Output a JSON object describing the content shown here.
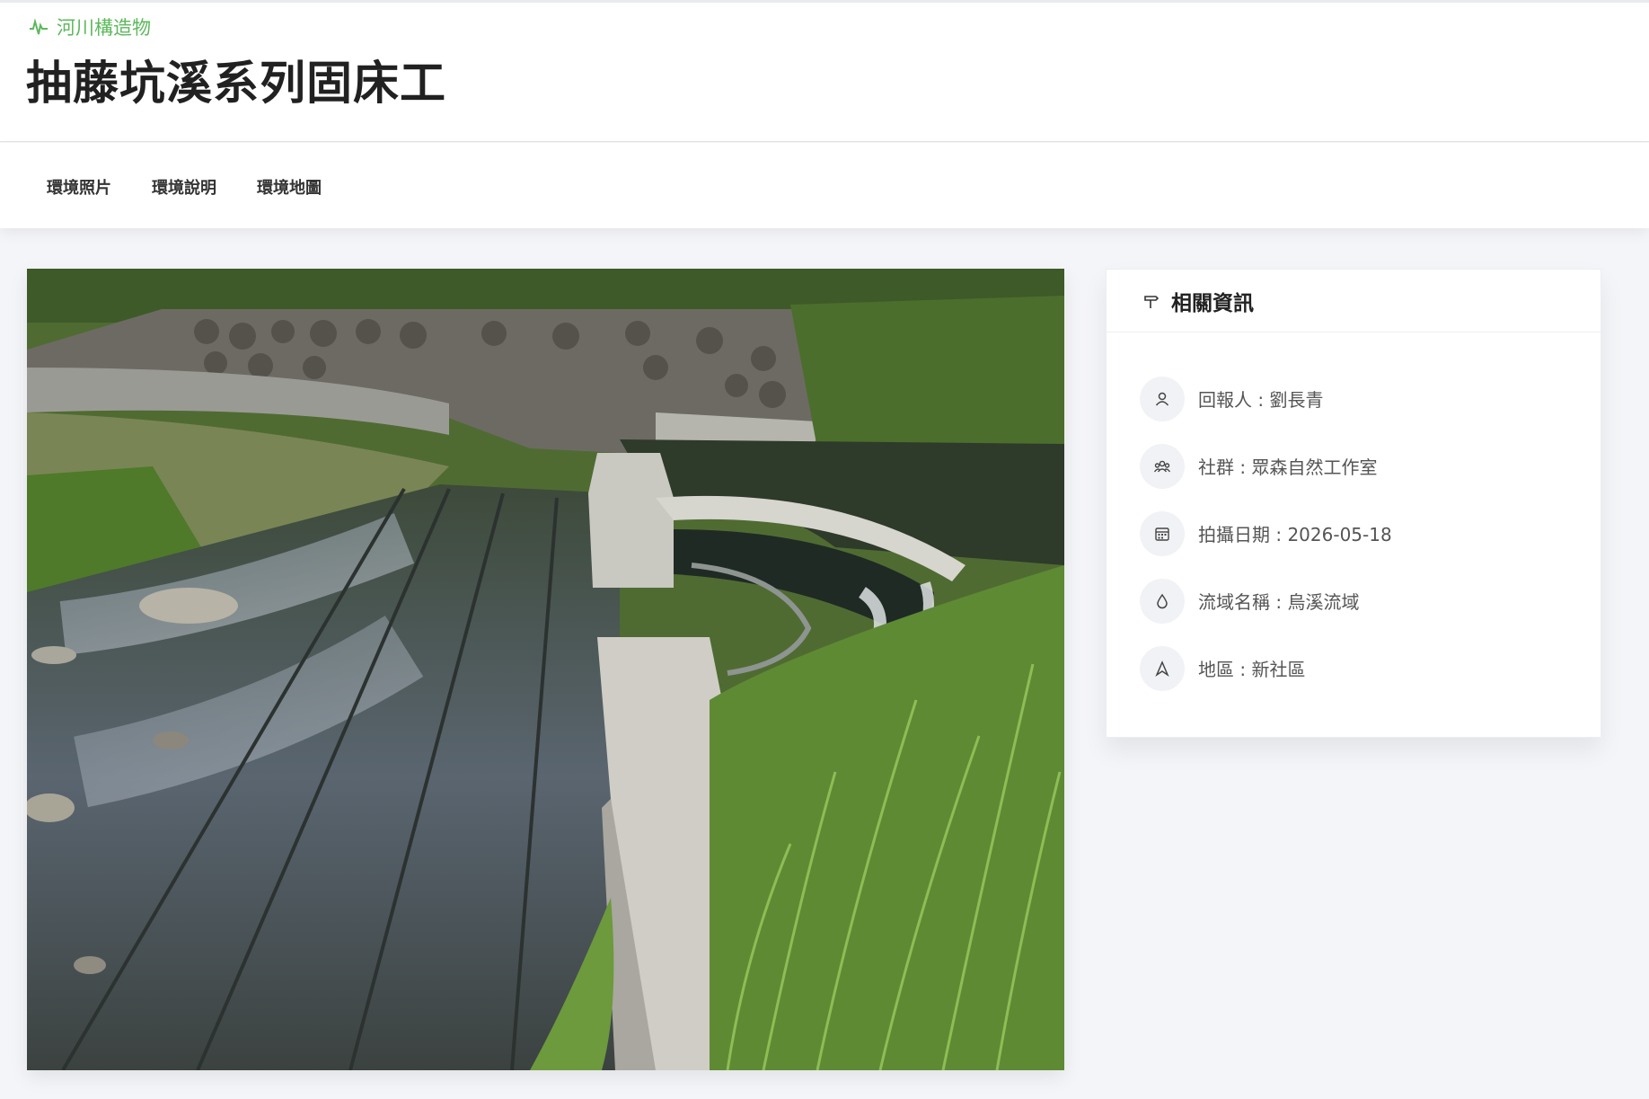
{
  "header": {
    "category": "河川構造物",
    "title": "抽藤坑溪系列固床工"
  },
  "tabs": [
    {
      "label": "環境照片"
    },
    {
      "label": "環境說明"
    },
    {
      "label": "環境地圖"
    }
  ],
  "photo": {
    "icon": "river-structure-photo"
  },
  "info_card": {
    "title": "相關資訊",
    "items": [
      {
        "icon": "user-icon",
        "text": "回報人 : 劉長青"
      },
      {
        "icon": "group-icon",
        "text": "社群 : 眾森自然工作室"
      },
      {
        "icon": "calendar-icon",
        "text": "拍攝日期 : 2026-05-18"
      },
      {
        "icon": "water-drop-icon",
        "text": "流域名稱 : 烏溪流域"
      },
      {
        "icon": "location-icon",
        "text": "地區 : 新社區"
      }
    ]
  },
  "colors": {
    "accent_green": "#5cb85c",
    "page_bg": "#f4f5f8"
  }
}
